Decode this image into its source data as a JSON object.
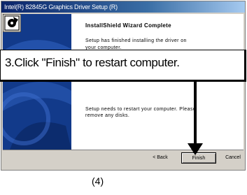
{
  "window": {
    "title": "Intel(R) 82845G Graphics Driver Setup (R)"
  },
  "wizard": {
    "heading": "InstallShield Wizard Complete",
    "body_text": "Setup has finished installing the driver on your computer.",
    "restart_text": "Setup needs to restart your computer. Please remove any disks."
  },
  "buttons": {
    "back": "< Back",
    "finish": "Finish",
    "cancel": "Cancel"
  },
  "callout": {
    "text": "3.Click \"Finish\" to restart computer."
  },
  "caption": "(4)",
  "colors": {
    "titlebar": "#0a246a",
    "side_panel": "#123a8a",
    "dialog_bg": "#d4d0c8"
  },
  "icons": [
    "wizard-install-icon",
    "arrow-down-icon"
  ]
}
